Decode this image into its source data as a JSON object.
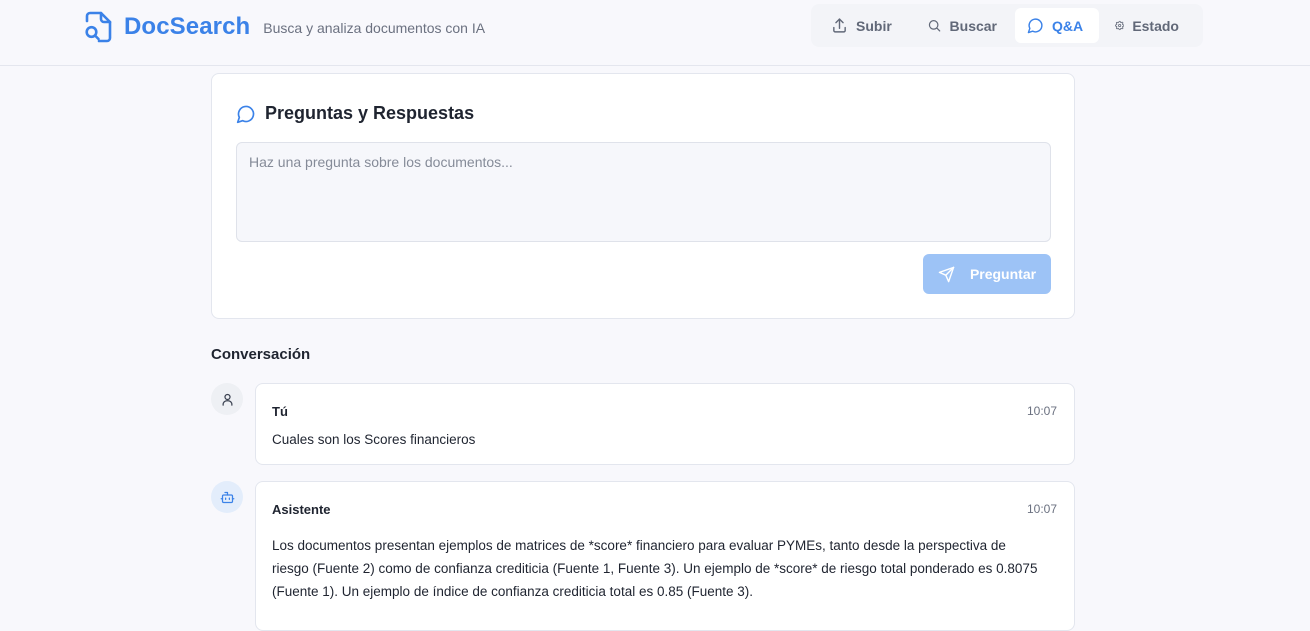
{
  "header": {
    "brand_name": "DocSearch",
    "tagline": "Busca y analiza documentos con IA",
    "accent_color": "#3b82e8"
  },
  "nav": {
    "items": [
      {
        "label": "Subir",
        "icon": "upload-icon",
        "active": false
      },
      {
        "label": "Buscar",
        "icon": "search-icon",
        "active": false
      },
      {
        "label": "Q&A",
        "icon": "chat-bubble-icon",
        "active": true
      },
      {
        "label": "Estado",
        "icon": "gear-icon",
        "active": false
      }
    ]
  },
  "qa": {
    "title": "Preguntas y Respuestas",
    "input_value": "",
    "input_placeholder": "Haz una pregunta sobre los documentos...",
    "submit_label": "Preguntar"
  },
  "conversation": {
    "title": "Conversación",
    "messages": [
      {
        "author": "Tú",
        "time": "10:07",
        "avatar_icon": "user-icon",
        "text": "Cuales son los Scores financieros"
      },
      {
        "author": "Asistente",
        "time": "10:07",
        "avatar_icon": "robot-icon",
        "text": "Los documentos presentan ejemplos de matrices de *score* financiero para evaluar PYMEs, tanto desde la perspectiva de riesgo (Fuente 2) como de confianza crediticia (Fuente 1, Fuente 3).  Un ejemplo de *score* de riesgo total ponderado es 0.8075 (Fuente 1). Un ejemplo de índice de confianza crediticia total es 0.85 (Fuente 3)."
      }
    ]
  }
}
